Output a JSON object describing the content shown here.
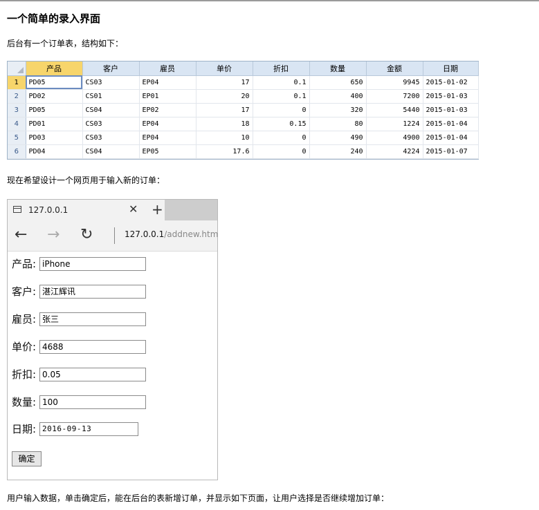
{
  "page": {
    "title": "一个简单的录入界面",
    "intro": "后台有一个订单表，结构如下：",
    "middle": "现在希望设计一个网页用于输入新的订单：",
    "footer": "用户输入数据，单击确定后，能在后台的表新增订单，并显示如下页面，让用户选择是否继续增加订单："
  },
  "sheet": {
    "headers": [
      "产品",
      "客户",
      "雇员",
      "单价",
      "折扣",
      "数量",
      "金额",
      "日期"
    ],
    "rows": [
      [
        "1",
        "PD05",
        "CS03",
        "EP04",
        "17",
        "0.1",
        "650",
        "9945",
        "2015-01-02"
      ],
      [
        "2",
        "PD02",
        "CS01",
        "EP01",
        "20",
        "0.1",
        "400",
        "7200",
        "2015-01-03"
      ],
      [
        "3",
        "PD05",
        "CS04",
        "EP02",
        "17",
        "0",
        "320",
        "5440",
        "2015-01-03"
      ],
      [
        "4",
        "PD01",
        "CS03",
        "EP04",
        "18",
        "0.15",
        "80",
        "1224",
        "2015-01-04"
      ],
      [
        "5",
        "PD03",
        "CS03",
        "EP04",
        "10",
        "0",
        "490",
        "4900",
        "2015-01-04"
      ],
      [
        "6",
        "PD04",
        "CS04",
        "EP05",
        "17.6",
        "0",
        "240",
        "4224",
        "2015-01-07"
      ]
    ]
  },
  "browser": {
    "tab_title": "127.0.0.1",
    "close_glyph": "✕",
    "new_tab_glyph": "+",
    "back_glyph": "←",
    "forward_glyph": "→",
    "refresh_glyph": "↻",
    "url_host": "127.0.0.1",
    "url_path": "/addnew.htm"
  },
  "form": {
    "fields": [
      {
        "label": "产品:",
        "value": "iPhone"
      },
      {
        "label": "客户:",
        "value": "湛江辉讯"
      },
      {
        "label": "雇员:",
        "value": "张三"
      },
      {
        "label": "单价:",
        "value": "4688"
      },
      {
        "label": "折扣:",
        "value": "0.05"
      },
      {
        "label": "数量:",
        "value": "100"
      },
      {
        "label": "日期:",
        "value": "2016-09-13"
      }
    ],
    "submit_label": "确定"
  }
}
